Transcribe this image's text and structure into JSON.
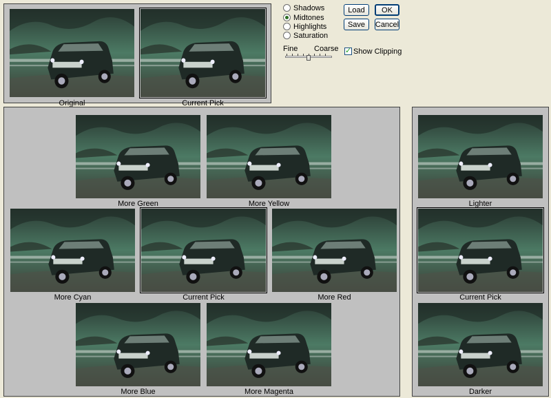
{
  "top_panel": {
    "thumbs": [
      {
        "label": "Original",
        "tint": "#4c7a64"
      },
      {
        "label": "Current Pick",
        "tint": "#5d7766"
      }
    ]
  },
  "tones": [
    {
      "label": "Shadows",
      "selected": false
    },
    {
      "label": "Midtones",
      "selected": true
    },
    {
      "label": "Highlights",
      "selected": false
    },
    {
      "label": "Saturation",
      "selected": false
    }
  ],
  "buttons": {
    "load": "Load",
    "ok": "OK",
    "save": "Save",
    "cancel": "Cancel"
  },
  "slider": {
    "left_label": "Fine",
    "right_label": "Coarse",
    "value": 0.5
  },
  "show_clipping": {
    "label": "Show Clipping",
    "checked": true
  },
  "variations": [
    {
      "label": "More Green",
      "tint": "#3f8b5a"
    },
    {
      "label": "More Yellow",
      "tint": "#7e8f5a"
    },
    {
      "label": "More Cyan",
      "tint": "#3f8273"
    },
    {
      "label": "Current Pick",
      "tint": "#5d7766",
      "selected": true
    },
    {
      "label": "More Red",
      "tint": "#7b6a55"
    },
    {
      "label": "More Blue",
      "tint": "#4a6577"
    },
    {
      "label": "More Magenta",
      "tint": "#6a5f6e"
    }
  ],
  "lightness": [
    {
      "label": "Lighter",
      "tint": "#728a7e"
    },
    {
      "label": "Current Pick",
      "tint": "#5d7766",
      "selected": true
    },
    {
      "label": "Darker",
      "tint": "#4c6a5b"
    }
  ]
}
